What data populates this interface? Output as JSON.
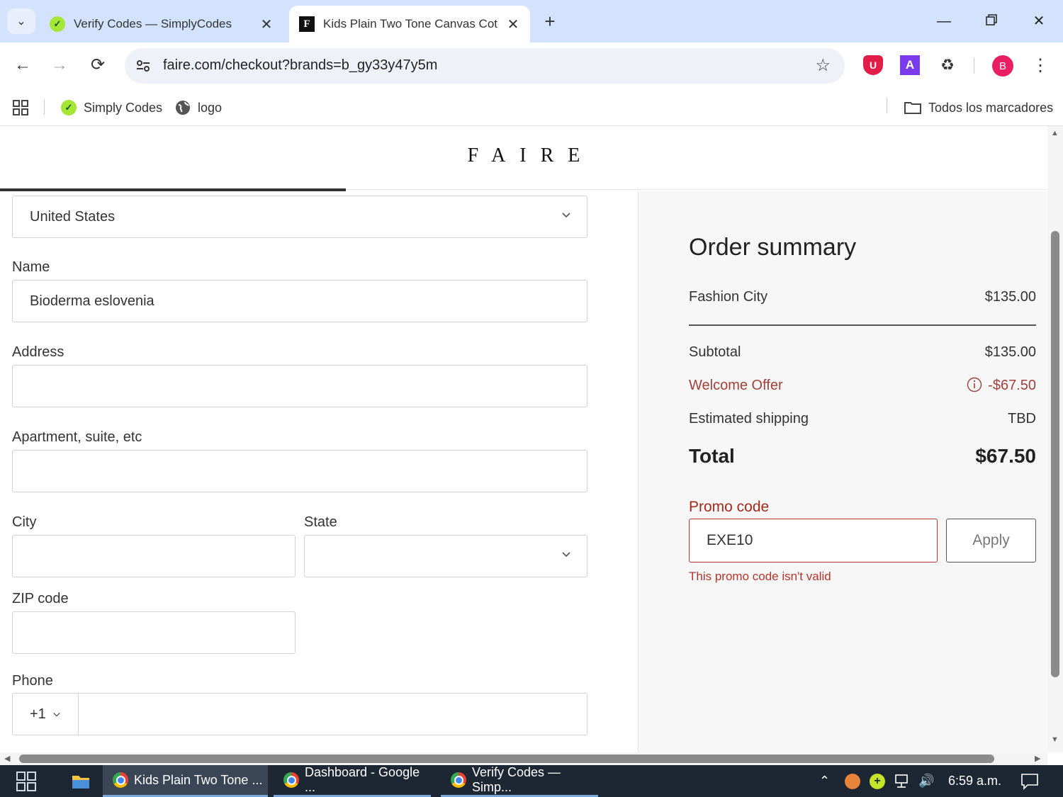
{
  "browser": {
    "tabs": [
      {
        "title": "Verify Codes — SimplyCodes",
        "favicon": "simplycodes-icon",
        "active": false
      },
      {
        "title": "Kids Plain Two Tone Canvas Cot",
        "favicon": "faire-icon",
        "active": true
      }
    ],
    "url": "faire.com/checkout?brands=b_gy33y47y5m",
    "profile_initial": "B",
    "extensions": {
      "u_label": "U",
      "a_label": "A"
    }
  },
  "bookmarks": {
    "items": [
      {
        "label": "Simply Codes",
        "icon": "simplycodes-icon"
      },
      {
        "label": "logo",
        "icon": "globe-icon"
      }
    ],
    "all_bookmarks": "Todos los marcadores"
  },
  "page": {
    "logo": "FAIRE",
    "form": {
      "country": "United States",
      "name_label": "Name",
      "name_value": "Bioderma eslovenia",
      "address_label": "Address",
      "address_value": "",
      "apartment_label": "Apartment, suite, etc",
      "apartment_value": "",
      "city_label": "City",
      "city_value": "",
      "state_label": "State",
      "state_value": "",
      "zip_label": "ZIP code",
      "zip_value": "",
      "phone_label": "Phone",
      "phone_code": "+1",
      "phone_value": ""
    },
    "summary": {
      "title": "Order summary",
      "brand": "Fashion City",
      "brand_amount": "$135.00",
      "subtotal_label": "Subtotal",
      "subtotal": "$135.00",
      "offer_label": "Welcome Offer",
      "offer_amount": "-$67.50",
      "shipping_label": "Estimated shipping",
      "shipping": "TBD",
      "total_label": "Total",
      "total": "$67.50",
      "promo_label": "Promo code",
      "promo_value": "EXE10",
      "apply_label": "Apply",
      "promo_error": "This promo code isn't valid"
    }
  },
  "taskbar": {
    "items": [
      {
        "label": "Kids Plain Two Tone ...",
        "state": "active"
      },
      {
        "label": "Dashboard - Google ...",
        "state": "open"
      },
      {
        "label": "Verify Codes — Simp...",
        "state": "open"
      }
    ],
    "clock": "6:59 a.m."
  },
  "colors": {
    "tabstrip": "#d3e3fd",
    "error": "#b8342a",
    "offer": "#a2403a",
    "taskbar": "#1d2733"
  }
}
